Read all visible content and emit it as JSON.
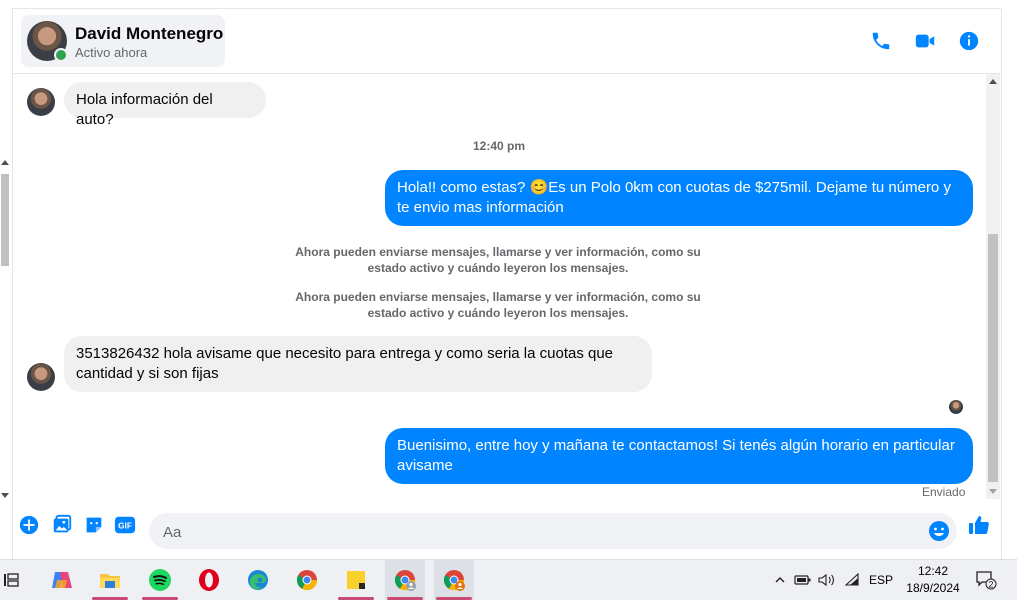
{
  "contact": {
    "name": "David Montenegro",
    "status": "Activo ahora"
  },
  "messages": {
    "incoming_1": "Hola información del auto?",
    "timestamp": "12:40 pm",
    "outgoing_1": "Hola!! como estas? 😊Es un Polo 0km con cuotas de $275mil. Dejame tu número y te envio mas información",
    "notice_1": "Ahora pueden enviarse mensajes, llamarse y ver información, como su estado activo y cuándo leyeron los mensajes.",
    "notice_2": "Ahora pueden enviarse mensajes, llamarse y ver información, como su estado activo y cuándo leyeron los mensajes.",
    "incoming_2": "3513826432 hola avisame que necesito para entrega y como seria la cuotas que cantidad y si son fijas",
    "outgoing_2": "Buenisimo, entre hoy y mañana te contactamos! Si tenés algún horario en particular avisame",
    "delivery_status": "Enviado"
  },
  "composer": {
    "placeholder": "Aa",
    "gif_label": "GIF"
  },
  "taskbar": {
    "apps": [
      "task-view",
      "copilot",
      "file-explorer",
      "spotify",
      "opera",
      "edge",
      "chrome",
      "sticky-notes",
      "chrome-profile-1",
      "chrome-profile-2"
    ],
    "language": "ESP",
    "time": "12:42",
    "date": "18/9/2024",
    "notifications": "2"
  },
  "colors": {
    "accent": "#0084ff",
    "online": "#31a24c",
    "incoming_bubble": "#f0f0f0"
  }
}
